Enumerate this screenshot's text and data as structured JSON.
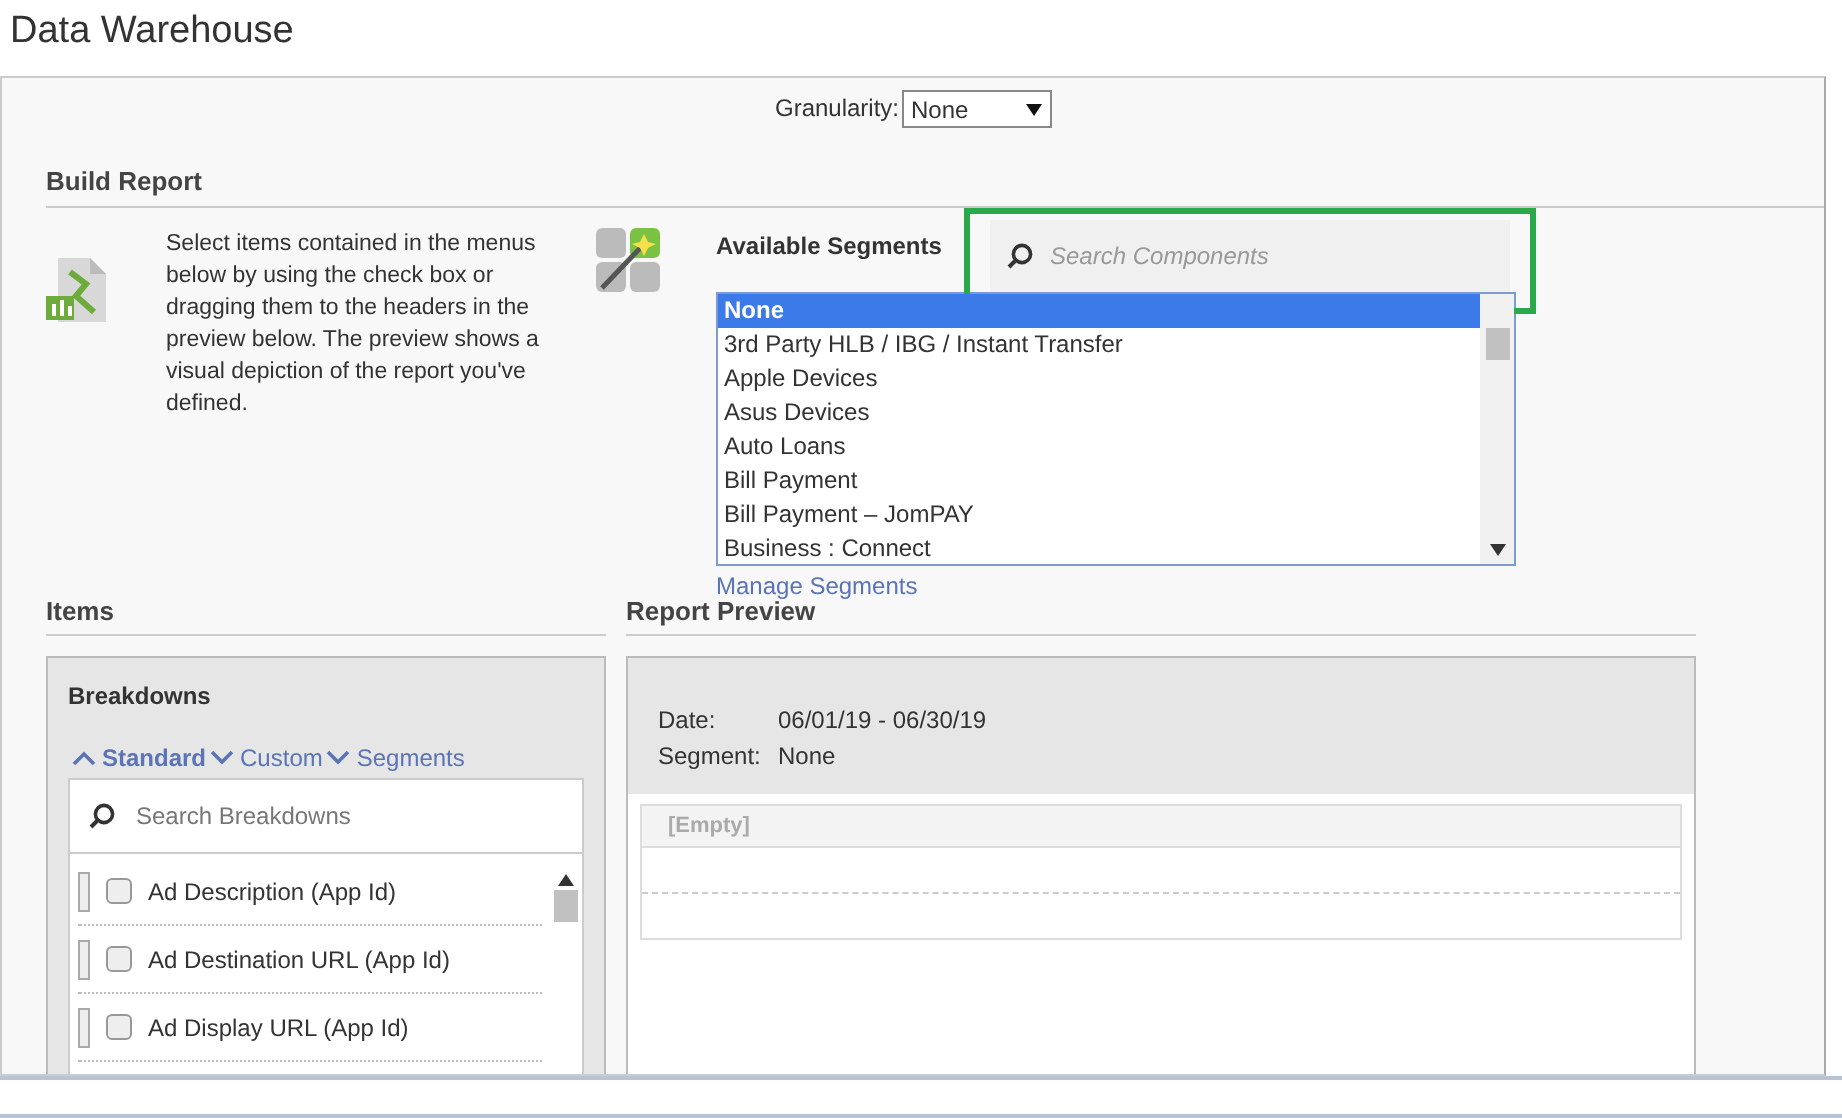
{
  "window": {
    "title": "Data Warehouse"
  },
  "granularity": {
    "label": "Granularity:",
    "value": "None"
  },
  "build_report": {
    "heading": "Build Report",
    "instructions": "Select items contained in the menus below by using the check box or dragging them to the headers in the preview below. The preview shows a visual depiction of the report you've defined.",
    "segments_label": "Available Segments",
    "search": {
      "placeholder": "Search Components"
    },
    "segments": [
      {
        "label": "None",
        "selected": true
      },
      {
        "label": "3rd Party HLB / IBG / Instant Transfer",
        "selected": false
      },
      {
        "label": "Apple Devices",
        "selected": false
      },
      {
        "label": "Asus Devices",
        "selected": false
      },
      {
        "label": "Auto Loans",
        "selected": false
      },
      {
        "label": "Bill Payment",
        "selected": false
      },
      {
        "label": "Bill Payment – JomPAY",
        "selected": false
      },
      {
        "label": "Business : Connect",
        "selected": false
      }
    ],
    "manage_link": "Manage Segments"
  },
  "items": {
    "heading": "Items",
    "panel_title": "Breakdowns",
    "filters": [
      {
        "label": "Standard",
        "expanded": true
      },
      {
        "label": "Custom",
        "expanded": false
      },
      {
        "label": "Segments",
        "expanded": false
      }
    ],
    "search": {
      "placeholder": "Search Breakdowns"
    },
    "rows": [
      {
        "label": "Ad Description (App Id)",
        "checked": false
      },
      {
        "label": "Ad Destination URL (App Id)",
        "checked": false
      },
      {
        "label": "Ad Display URL (App Id)",
        "checked": false
      }
    ]
  },
  "report_preview": {
    "heading": "Report Preview",
    "fields": [
      {
        "label": "Date:",
        "value": "06/01/19 - 06/30/19"
      },
      {
        "label": "Segment:",
        "value": "None"
      }
    ],
    "table_header": "[Empty]"
  }
}
